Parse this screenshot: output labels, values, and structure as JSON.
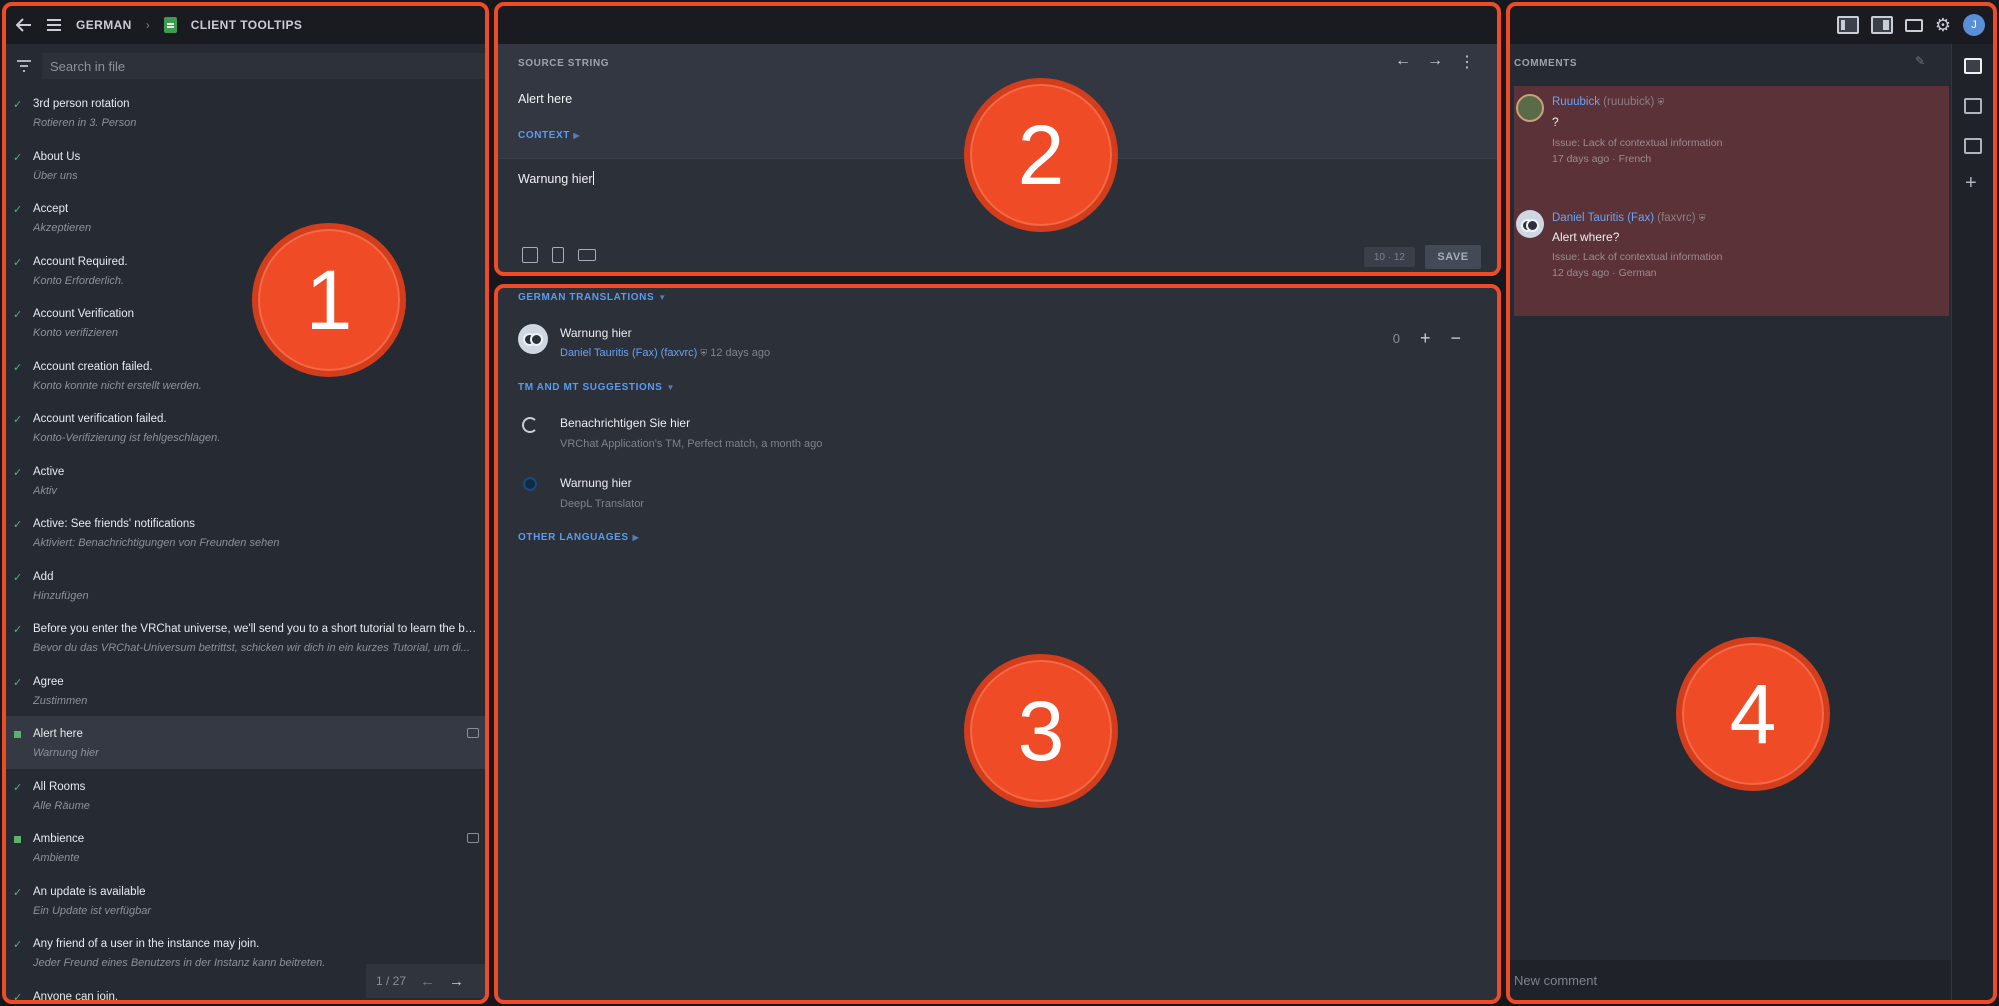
{
  "header": {
    "project": "GERMAN",
    "file": "CLIENT TOOLTIPS"
  },
  "search": {
    "placeholder": "Search in file"
  },
  "strings": [
    {
      "source": "3rd person rotation",
      "translation": "Rotieren in 3. Person",
      "status": "approved"
    },
    {
      "source": "About Us",
      "translation": "Über uns",
      "status": "approved"
    },
    {
      "source": "Accept",
      "translation": "Akzeptieren",
      "status": "approved"
    },
    {
      "source": "Account Required.",
      "translation": "Konto Erforderlich.",
      "status": "approved"
    },
    {
      "source": "Account Verification",
      "translation": "Konto verifizieren",
      "status": "approved"
    },
    {
      "source": "Account creation failed.",
      "translation": "Konto konnte nicht erstellt werden.",
      "status": "approved"
    },
    {
      "source": "Account verification failed.",
      "translation": "Konto-Verifizierung ist fehlgeschlagen.",
      "status": "approved"
    },
    {
      "source": "Active",
      "translation": "Aktiv",
      "status": "approved"
    },
    {
      "source": "Active: See friends' notifications",
      "translation": "Aktiviert: Benachrichtigungen von Freunden sehen",
      "status": "approved"
    },
    {
      "source": "Add",
      "translation": "Hinzufügen",
      "status": "approved"
    },
    {
      "source": "Before you enter the VRChat universe, we'll send you to a short tutorial to learn the ba...",
      "translation": "Bevor du das VRChat-Universum betrittst, schicken wir dich in ein kurzes Tutorial, um di...",
      "status": "approved"
    },
    {
      "source": "Agree",
      "translation": "Zustimmen",
      "status": "approved"
    },
    {
      "source": "Alert here",
      "translation": "Warnung hier",
      "status": "translated",
      "selected": true,
      "has_comment": true
    },
    {
      "source": "All Rooms",
      "translation": "Alle Räume",
      "status": "approved"
    },
    {
      "source": "Ambience",
      "translation": "Ambiente",
      "status": "translated",
      "has_comment": true
    },
    {
      "source": "An update is available",
      "translation": "Ein Update ist verfügbar",
      "status": "approved"
    },
    {
      "source": "Any friend of a user in the instance may join.",
      "translation": "Jeder Freund eines Benutzers in der Instanz kann beitreten.",
      "status": "approved"
    },
    {
      "source": "Anyone can join.",
      "translation": "",
      "status": "approved"
    }
  ],
  "pager": {
    "label": "1 / 27"
  },
  "editor": {
    "source_label": "SOURCE STRING",
    "source_text": "Alert here",
    "context_label": "CONTEXT",
    "translation_value": "Warnung hier",
    "counter": "10 · 12",
    "save_label": "SAVE"
  },
  "translations": {
    "label": "GERMAN TRANSLATIONS",
    "items": [
      {
        "text": "Warnung hier",
        "author": "Daniel Tauritis (Fax) (faxvrc)",
        "time": "12 days ago",
        "votes": "0"
      }
    ]
  },
  "suggestions": {
    "label": "TM AND MT SUGGESTIONS",
    "items": [
      {
        "text": "Benachrichtigen Sie hier",
        "meta": "VRChat Application's TM, Perfect match, a month ago",
        "icon": "tm-icon"
      },
      {
        "text": "Warnung hier",
        "meta": "DeepL Translator",
        "icon": "deepl-icon"
      }
    ]
  },
  "other_languages": {
    "label": "OTHER LANGUAGES"
  },
  "comments": {
    "label": "COMMENTS",
    "items": [
      {
        "name": "Ruuubick",
        "handle": "(ruuubick)",
        "text": "?",
        "issue": "Issue: Lack of contextual information",
        "time": "17 days ago",
        "language": "French"
      },
      {
        "name": "Daniel Tauritis (Fax)",
        "handle": "(faxvrc)",
        "text": "Alert where?",
        "issue": "Issue: Lack of contextual information",
        "time": "12 days ago",
        "language": "German"
      }
    ],
    "new_placeholder": "New comment"
  },
  "user": {
    "initial": "J"
  },
  "callouts": [
    "1",
    "2",
    "3",
    "4"
  ],
  "colors": {
    "accent": "#ef4b26",
    "link": "#5b9bf0",
    "approved": "#59b36a",
    "issue_bg": "#5a3237"
  }
}
